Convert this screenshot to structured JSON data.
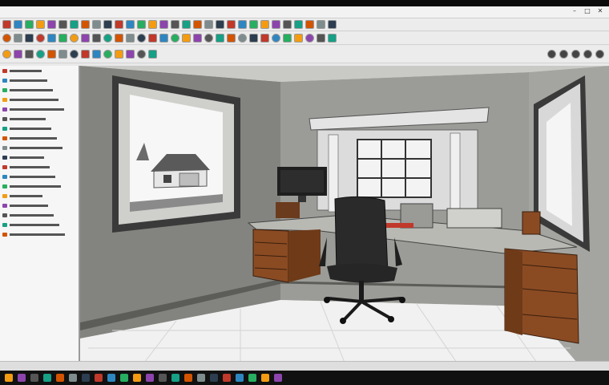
{
  "window": {
    "title": "",
    "menus": [],
    "controls": {
      "minimize": "–",
      "maximize": "□",
      "close": "✕"
    }
  },
  "toolbar_icons": [
    "select-icon",
    "pencil-icon",
    "eraser-icon",
    "line-icon",
    "rectangle-icon",
    "circle-icon",
    "arc-icon",
    "push-pull-icon",
    "move-icon",
    "rotate-icon",
    "scale-icon",
    "offset-icon",
    "tape-icon",
    "text-icon",
    "paint-icon",
    "orbit-icon",
    "pan-icon",
    "zoom-icon",
    "zoom-extents-icon",
    "camera-icon",
    "walk-icon",
    "look-icon",
    "section-icon",
    "layer-icon",
    "material-icon",
    "component-icon",
    "group-icon",
    "style-icon",
    "shadow-icon",
    "fog-icon"
  ],
  "left_panel": {
    "item_count": 18
  },
  "scene": {
    "description_visible": false
  },
  "status": {
    "right_text": ""
  },
  "colors": {
    "wall": "#8f908b",
    "floor": "#f2f2f2",
    "desk_wood": "#8a4b23",
    "chair": "#2a2a2a",
    "accent_red": "#c0392b"
  }
}
